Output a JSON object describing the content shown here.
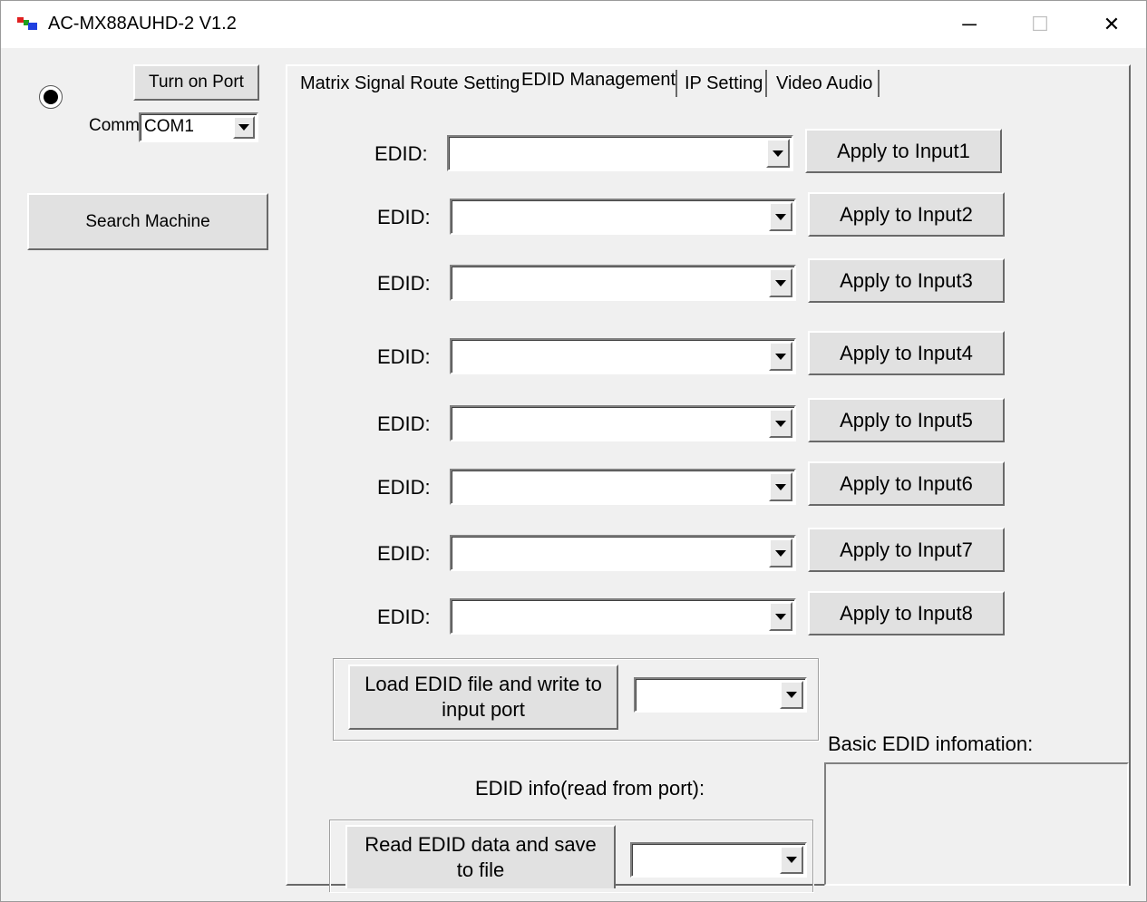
{
  "window": {
    "title": "AC-MX88AUHD-2 V1.2",
    "controls": {
      "minimize": "─",
      "maximize": "☐",
      "close": "✕"
    }
  },
  "left_panel": {
    "turn_on_port_label": "Turn on Port",
    "comm_label": "Comm:",
    "comm_value": "COM1",
    "search_machine_label": "Search Machine"
  },
  "tabs": [
    {
      "label": "Matrix Signal Route Setting"
    },
    {
      "label": "EDID Management"
    },
    {
      "label": "IP Setting"
    },
    {
      "label": "Video  Audio"
    }
  ],
  "active_tab": "EDID Management",
  "edid_rows": [
    {
      "label": "EDID:",
      "value": "",
      "button": "Apply to Input1"
    },
    {
      "label": "EDID:",
      "value": "",
      "button": "Apply to Input2"
    },
    {
      "label": "EDID:",
      "value": "",
      "button": "Apply to Input3"
    },
    {
      "label": "EDID:",
      "value": "",
      "button": "Apply to Input4"
    },
    {
      "label": "EDID:",
      "value": "",
      "button": "Apply to Input5"
    },
    {
      "label": "EDID:",
      "value": "",
      "button": "Apply to Input6"
    },
    {
      "label": "EDID:",
      "value": "",
      "button": "Apply to Input7"
    },
    {
      "label": "EDID:",
      "value": "",
      "button": "Apply to Input8"
    }
  ],
  "load_edid": {
    "button_line1": "Load EDID file and write to",
    "button_line2": "input port",
    "port_value": ""
  },
  "basic_info_label": "Basic EDID infomation:",
  "edid_info_label": "EDID info(read from port):",
  "read_edid": {
    "button_line1": "Read EDID data and save",
    "button_line2": "to file",
    "port_value": ""
  },
  "colors": {
    "face": "#f0f0f0",
    "button": "#e1e1e1",
    "shadow": "#696969",
    "highlight": "#ffffff"
  }
}
